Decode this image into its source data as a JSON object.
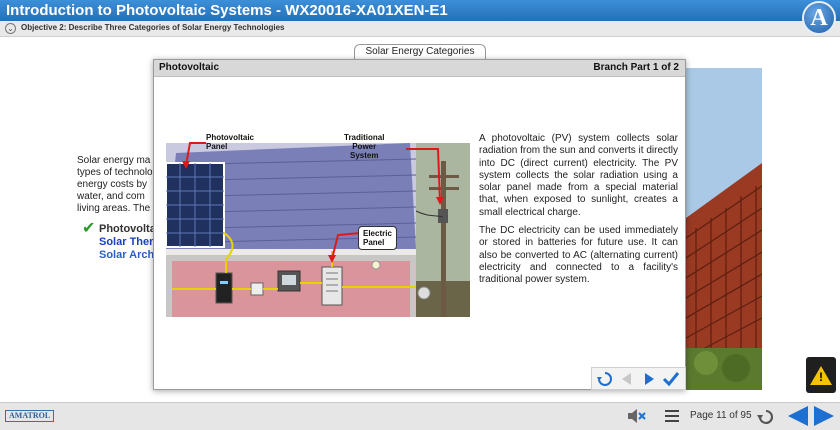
{
  "header": {
    "title": "Introduction to Photovoltaic Systems - WX20016-XA01XEN-E1",
    "logo_letter": "A"
  },
  "objective": {
    "text": "Objective 2: Describe Three Categories of Solar Energy Technologies"
  },
  "background_page": {
    "section_tab": "Solar Energy Categories",
    "paragraph_lines": [
      "Solar energy ma",
      "types of technolo",
      "energy costs by",
      "water, and com",
      "living areas. The"
    ],
    "list_items": [
      {
        "label": "Photovolta",
        "checked": true
      },
      {
        "label": "Solar Ther",
        "checked": false
      },
      {
        "label": "Solar Arch",
        "checked": false
      }
    ]
  },
  "modal": {
    "title": "Photovoltaic",
    "branch": "Branch Part 1 of 2",
    "paragraphs": [
      "A photovoltaic (PV) system collects solar radiation from the sun and converts it directly into DC (direct current) electricity. The PV system collects the solar radiation using a solar panel made from a special material that, when exposed to sunlight, creates a small electrical charge.",
      "The DC electricity can be used immediately or stored in batteries for future use. It can also be converted to AC (alternating current) electricity and connected to a facility's traditional power system."
    ],
    "diagram": {
      "label_pv_panel": "Photovoltaic\nPanel",
      "label_power_system": "Traditional\nPower\nSystem",
      "label_electric_panel": "Electric\nPanel"
    }
  },
  "footer": {
    "logo": "AMATROL",
    "page_label": "Page 11 of 95"
  },
  "colors": {
    "header_blue": "#2f7fcc",
    "link_blue": "#1a3fbf",
    "check_green": "#2a9a2a",
    "control_blue": "#1d6fd1",
    "warning_yellow": "#f4c400"
  }
}
